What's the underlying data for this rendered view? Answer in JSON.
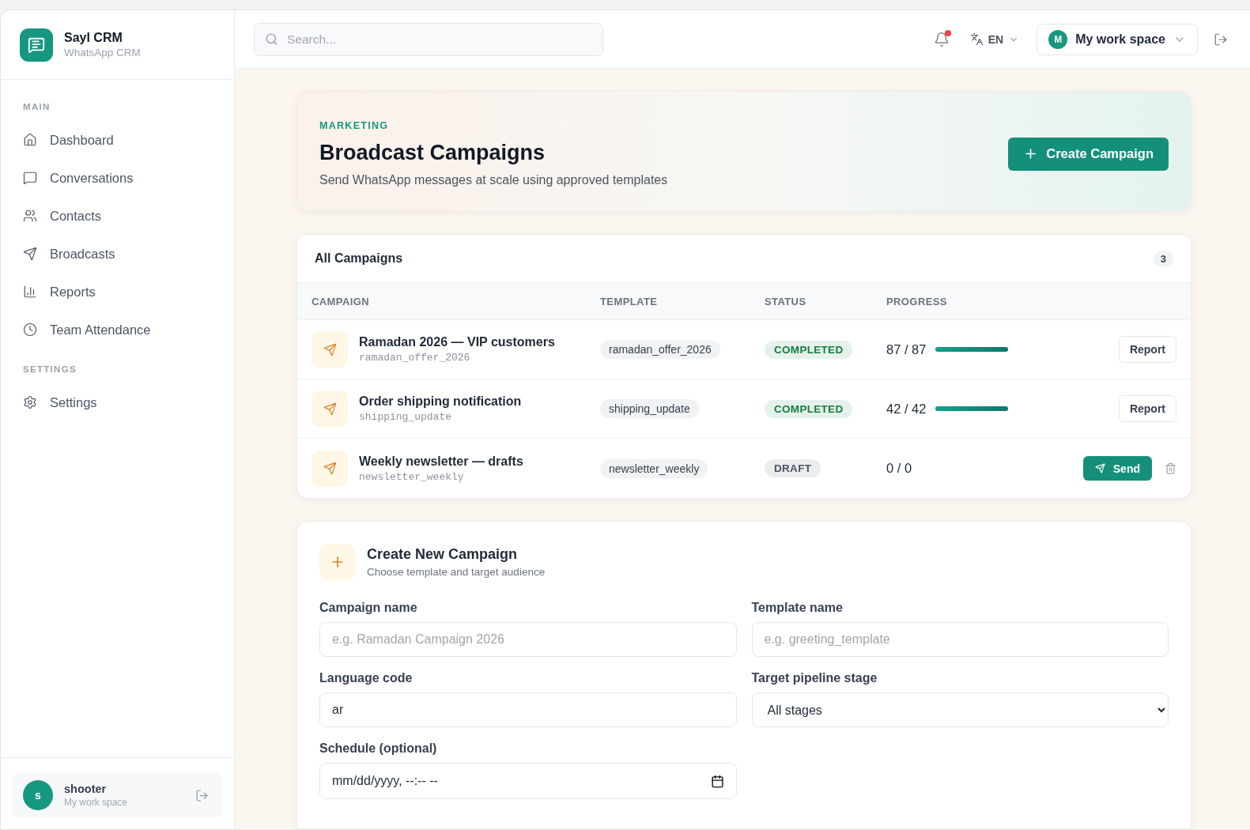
{
  "brand": {
    "name": "Sayl CRM",
    "subtitle": "WhatsApp CRM"
  },
  "sidebar": {
    "sections": [
      {
        "title": "MAIN",
        "items": [
          {
            "label": "Dashboard",
            "selected": false
          },
          {
            "label": "Conversations",
            "selected": false
          },
          {
            "label": "Contacts",
            "selected": false
          },
          {
            "label": "Broadcasts",
            "selected": false
          },
          {
            "label": "Reports",
            "selected": false
          },
          {
            "label": "Team Attendance",
            "selected": false
          }
        ]
      },
      {
        "title": "SETTINGS",
        "items": [
          {
            "label": "Settings",
            "selected": false
          }
        ]
      }
    ],
    "user": {
      "initial": "s",
      "name": "shooter",
      "workspace": "My work space"
    }
  },
  "topbar": {
    "search": {
      "placeholder": "Search..."
    },
    "notification_dot": true,
    "language": "EN",
    "workspace": {
      "initial": "M",
      "name": "My work space"
    }
  },
  "hero": {
    "eyebrow": "MARKETING",
    "title": "Broadcast Campaigns",
    "subtitle": "Send WhatsApp messages at scale using approved templates",
    "button": "Create Campaign"
  },
  "table": {
    "title": "All Campaigns",
    "count": "3",
    "columns": [
      "CAMPAIGN",
      "TEMPLATE",
      "STATUS",
      "PROGRESS"
    ],
    "rows": [
      {
        "name": "Ramadan 2026 — VIP customers",
        "template_id": "ramadan_offer_2026",
        "template": "ramadan_offer_2026",
        "status": "COMPLETED",
        "color": "#15803d",
        "progress": "87 / 87",
        "level": 1,
        "actions": [
          {
            "kind": "report",
            "label": "Report"
          }
        ]
      },
      {
        "name": "Order shipping notification",
        "template_id": "shipping_update",
        "template": "shipping_update",
        "status": "COMPLETED",
        "color": "#15803d",
        "progress": "42 / 42",
        "level": 1,
        "actions": [
          {
            "kind": "report",
            "label": "Report"
          }
        ]
      },
      {
        "name": "Weekly newsletter — drafts",
        "template_id": "newsletter_weekly",
        "template": "newsletter_weekly",
        "status": "DRAFT",
        "color": "#4b5563",
        "progress": "0 / 0",
        "actions": [
          {
            "kind": "send",
            "label": "Send"
          },
          {
            "kind": "delete"
          }
        ]
      }
    ]
  },
  "form": {
    "title": "Create New Campaign",
    "subtitle": "Choose template and target audience",
    "fields": [
      {
        "kind": "text",
        "label": "Campaign name",
        "placeholder": "e.g. Ramadan Campaign 2026"
      },
      {
        "kind": "text",
        "label": "Template name",
        "placeholder": "e.g. greeting_template"
      },
      {
        "kind": "text",
        "label": "Language code",
        "value": "ar"
      },
      {
        "kind": "select",
        "label": "Target pipeline stage",
        "value": "All stages"
      },
      {
        "kind": "datetime",
        "label": "Schedule (optional)",
        "placeholder": "mm/dd/yyyy, --:-- --"
      }
    ]
  }
}
